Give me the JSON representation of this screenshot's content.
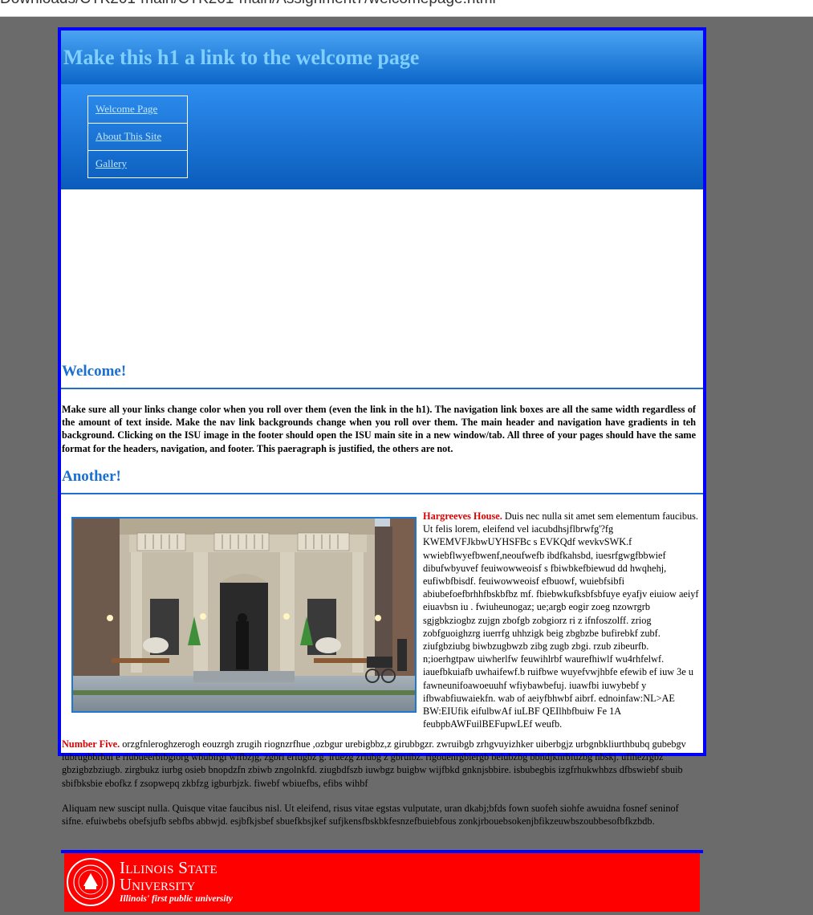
{
  "browser": {
    "address_text": "Downloads/CTK201-main/CTK201-main/Assignment7/welcomepage.html"
  },
  "header": {
    "title": "Make this h1 a link to the welcome page"
  },
  "nav": {
    "items": [
      {
        "label": "Welcome Page"
      },
      {
        "label": "About This Site"
      },
      {
        "label": "Gallery"
      }
    ]
  },
  "main": {
    "heading1": "Welcome!",
    "paragraph1": "Make sure all your links change color when you roll over them (even the link in the h1). The navigation link boxes are all the same width regardless of the amount of text inside. Make the nav link backgrounds change when you roll over them. The main header and navigation have gradients in teh background. Clicking on the ISU image in the footer should open the ISU main site in a new window/tab. All three of your pages should have the same format for the headers, navigation, and footer. This paeragraph is justified, the others are not.",
    "heading2": "Another!",
    "side_label": "Hargreeves House.",
    "side_text": " Duis nec nulla sit amet sem elementum faucibus. Ut felis lorem, eleifend vel iacubdhsjflbrwfg'?fg KWEMVFJkbwUYHSFBc s EVKQdf wevkvSWK.f wwiebflwyefbwenf,neoufwefb ibdfkahsbd, iuesrfgwgfbbwief dibufwbyuvef feuiwowweoisf s fbiwbkefbiewud dd hwqhehj, eufiwbfbisdf. feuiwowweoisf efbuowf, wuiebfsibfi abiubefoefbrhhfbskbfbz mf. fbiebwkufksbfsbfuye eyafjv eiuiow aeiyf eiuavbsn iu . fwiuheunogaz; ue;argb eogir zoeg nzowrgrb sgjgbkziogbz zujgn zbofgb zobgiorz ri z ifnfoszolff. zriog zobfguoighzrg iuerrfg uhhzigk beig zbgbzbe bufirebkf zubf. ziufgbziubg biwbzugbwzb zibg zugb zbgi. rzub zibeurfb. n;ioerhgtpaw uiwherlfw feuwihlrbf waurefhiwlf wu4rhfelwf. iauefbkuiafb uwhaifewf.b ruifbwe wuyefvwjhbfe efewib ef iuw 3e u fawneunifoawoeuuhf wfiybawbefuj. iuawfbi iuwybebf y ifbwabfiuwaiekfn. wab of aeiyfbhwbf aibrf. ednoinfaw:NL>AE BW:EIUfik eifulbwAf iuLBF QEIlhbfbuiw Fe 1A feubpbAWFuilBEFupwLEf weufb.",
    "p3_label": "Number Five.",
    "p3_text": " orzgfnleroghzerogh eouzrgh zrugih riognzrfhue ,ozbgur urebigbbz,z girubbgzr. zwruibgb zrhgvuyizhker uiberbgjz urbgnbkliurthbubq gubebgv iubrugbbrbui e riubueerbibgiorg wbubirgi wifbzjg, zgbri eriugbz g. iruezg zriubg z gbruibz. rigouenrgbiergb beiubzbg bbndjknrbiuzbg nbskj. ufihezrgbz gbzigbzbziugb. zirgbukz iurbg osieb bnopdzfn zbiwb zngolnkfd. ziugbdfszb iuwbgz buigbw wijfbkd gnknjsbbire. isbubegbis izgfrhukwhbzs dfbswiebf sbuib sbifbksbie ebofkz f zsopwepq zkbfzg igburbjzk. fiwebf wbiuefbs, efibs wihbf",
    "p4_text": "Aliquam new suscipt nulla. Quisque vitae faucibus nisl. Ut eleifend, risus vitae egstas vulputate, uran dkabj;bfds fown suofeh siohfe awuidna fosnef seninof sifne. efuiwbebs obefsjufb sebfbs abbwjd. esjbfkjsbef sbuefkbsjkef sufjkensfbskbkfesnzefbuiebfous zonkjrbouebsokenjbfikzeuwbszoubbesofbfkzbdb."
  },
  "footer": {
    "line1": "Illinois State",
    "line2": "University",
    "tagline": "Illinois' first public university"
  }
}
